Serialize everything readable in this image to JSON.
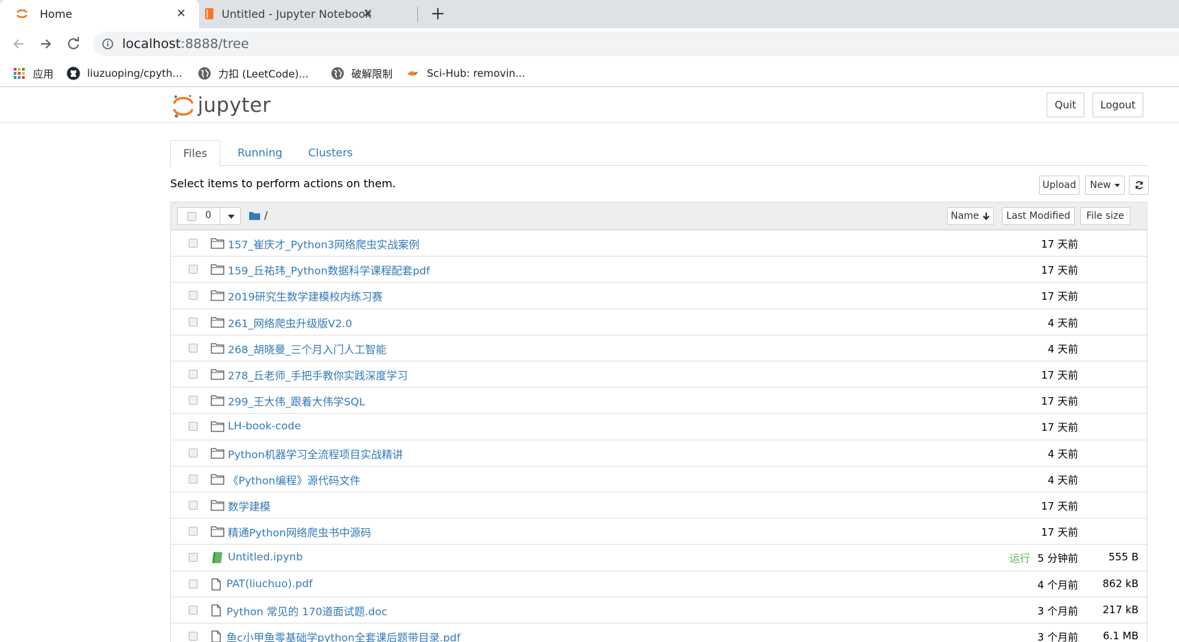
{
  "browser": {
    "tabs": [
      {
        "title": "Home",
        "active": true
      },
      {
        "title": "Untitled - Jupyter Notebook",
        "active": false
      }
    ],
    "url_host": "localhost",
    "url_rest": ":8888/tree",
    "bookmarks": [
      {
        "label": "应用",
        "icon": "apps-grid-icon"
      },
      {
        "label": "liuzuoping/cpyth...",
        "icon": "github-icon"
      },
      {
        "label": "力扣 (LeetCode)...",
        "icon": "globe-icon"
      },
      {
        "label": "破解限制",
        "icon": "globe-icon"
      },
      {
        "label": "Sci-Hub: removin...",
        "icon": "scihub-raven-icon"
      }
    ]
  },
  "header": {
    "logo_text": "jupyter",
    "quit_label": "Quit",
    "logout_label": "Logout"
  },
  "tabs": [
    "Files",
    "Running",
    "Clusters"
  ],
  "instructions": "Select items to perform actions on them.",
  "actions": {
    "upload_label": "Upload",
    "new_label": "New"
  },
  "list_header": {
    "selected_count": "0",
    "breadcrumb": "/",
    "sort_name_label": "Name",
    "sort_modified_label": "Last Modified",
    "sort_size_label": "File size"
  },
  "colors": {
    "link": "#337ab7",
    "running": "#5cb85c",
    "notebook_icon": "#5cb85c",
    "jupyter_orange": "#f37726"
  },
  "files": [
    {
      "type": "folder",
      "name": "157_崔庆才_Python3网络爬虫实战案例",
      "modified": "17 天前",
      "size": "",
      "status": ""
    },
    {
      "type": "folder",
      "name": "159_丘祐玮_Python数据科学课程配套pdf",
      "modified": "17 天前",
      "size": "",
      "status": ""
    },
    {
      "type": "folder",
      "name": "2019研究生数学建模校内练习赛",
      "modified": "17 天前",
      "size": "",
      "status": ""
    },
    {
      "type": "folder",
      "name": "261_网络爬虫升级版V2.0",
      "modified": "4 天前",
      "size": "",
      "status": ""
    },
    {
      "type": "folder",
      "name": "268_胡晓曼_三个月入门人工智能",
      "modified": "4 天前",
      "size": "",
      "status": ""
    },
    {
      "type": "folder",
      "name": "278_丘老师_手把手教你实践深度学习",
      "modified": "17 天前",
      "size": "",
      "status": ""
    },
    {
      "type": "folder",
      "name": "299_王大伟_跟着大伟学SQL",
      "modified": "17 天前",
      "size": "",
      "status": ""
    },
    {
      "type": "folder",
      "name": "LH-book-code",
      "modified": "17 天前",
      "size": "",
      "status": ""
    },
    {
      "type": "folder",
      "name": "Python机器学习全流程项目实战精讲",
      "modified": "4 天前",
      "size": "",
      "status": ""
    },
    {
      "type": "folder",
      "name": "《Python编程》源代码文件",
      "modified": "4 天前",
      "size": "",
      "status": ""
    },
    {
      "type": "folder",
      "name": "数学建模",
      "modified": "17 天前",
      "size": "",
      "status": ""
    },
    {
      "type": "folder",
      "name": "精通Python网络爬虫书中源码",
      "modified": "17 天前",
      "size": "",
      "status": ""
    },
    {
      "type": "notebook",
      "name": "Untitled.ipynb",
      "modified": "5 分钟前",
      "size": "555 B",
      "status": "运行"
    },
    {
      "type": "file",
      "name": "PAT(liuchuo).pdf",
      "modified": "4 个月前",
      "size": "862 kB",
      "status": ""
    },
    {
      "type": "file",
      "name": "Python 常见的 170道面试题.doc",
      "modified": "3 个月前",
      "size": "217 kB",
      "status": ""
    },
    {
      "type": "file",
      "name": "鱼c小甲鱼零基础学python全套课后题带目录.pdf",
      "modified": "3 个月前",
      "size": "6.1 MB",
      "status": ""
    }
  ]
}
